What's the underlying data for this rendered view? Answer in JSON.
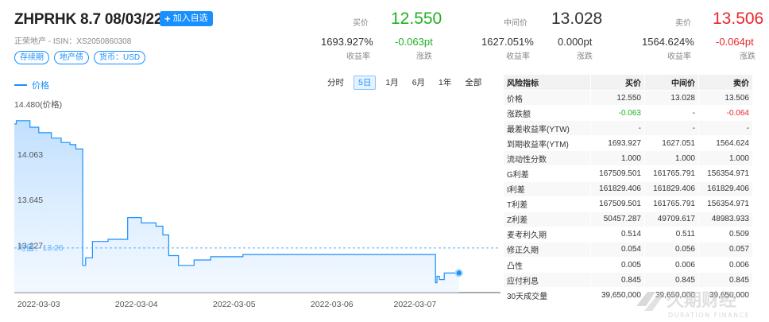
{
  "header": {
    "title": "ZHPRHK 8.7 08/03/22",
    "add_button": "加入自选",
    "subtitle": "正荣地产 - ISIN：XS2050860308",
    "tags": [
      "存续期",
      "地产债",
      "货币：USD"
    ]
  },
  "quotes": {
    "bid": {
      "label": "买价",
      "price": "12.550",
      "yield": "1693.927%",
      "yield_label": "收益率",
      "change": "-0.063pt",
      "change_label": "涨跌"
    },
    "mid": {
      "label": "中间价",
      "price": "13.028",
      "yield": "1627.051%",
      "yield_label": "收益率",
      "change": "0.000pt",
      "change_label": "涨跌"
    },
    "ask": {
      "label": "卖价",
      "price": "13.506",
      "yield": "1564.624%",
      "yield_label": "收益率",
      "change": "-0.064pt",
      "change_label": "涨跌"
    }
  },
  "colors": {
    "accent": "#1890ff",
    "up": "#e8262b",
    "down": "#21b025"
  },
  "chart_controls": {
    "legend": "价格",
    "ranges": [
      "分时",
      "5日",
      "1月",
      "6月",
      "1年",
      "全部"
    ],
    "active_range": "5日"
  },
  "chart_data": {
    "type": "area",
    "y_axis_title": "14.480(价格)",
    "yticks": [
      "14.063",
      "13.645",
      "13.227"
    ],
    "ylim": [
      12.85,
      14.48
    ],
    "avg_label": "均值：13.26",
    "avg_value": 13.26,
    "x_labels": [
      "2022-03-03",
      "2022-03-04",
      "2022-03-05",
      "2022-03-06",
      "2022-03-07"
    ],
    "x_label_t": [
      0.25,
      1.25,
      2.25,
      3.25,
      4.1
    ],
    "x_range": [
      0,
      4.65
    ],
    "series": [
      {
        "t": [
          0,
          0.02,
          0.02,
          0.16,
          0.16,
          0.25,
          0.25,
          0.38,
          0.38,
          0.48,
          0.48,
          0.57,
          0.57,
          0.63,
          0.63,
          0.7,
          0.7,
          0.73,
          0.73,
          0.8,
          0.8,
          0.96,
          0.96,
          1.16,
          1.16,
          1.3,
          1.3,
          1.45,
          1.45,
          1.52,
          1.52,
          1.58,
          1.58,
          1.68,
          1.68,
          1.84,
          1.84,
          2.01,
          2.01,
          2.34,
          2.34,
          4.31,
          4.31,
          4.325,
          4.325,
          4.35,
          4.35,
          4.4,
          4.4,
          4.55
        ],
        "values": [
          14.4,
          14.4,
          14.43,
          14.43,
          14.37,
          14.37,
          14.32,
          14.32,
          14.27,
          14.27,
          14.23,
          14.23,
          14.21,
          14.21,
          14.17,
          14.17,
          13.1,
          13.1,
          13.17,
          13.17,
          13.32,
          13.32,
          13.34,
          13.34,
          13.54,
          13.54,
          13.49,
          13.49,
          13.46,
          13.46,
          13.38,
          13.38,
          13.19,
          13.19,
          13.1,
          13.1,
          13.15,
          13.15,
          13.18,
          13.18,
          13.2,
          13.2,
          12.94,
          12.94,
          13.0,
          13.0,
          12.97,
          12.97,
          13.03,
          13.03
        ]
      }
    ],
    "last_value": 13.03
  },
  "table": {
    "headers": [
      "风险指标",
      "买价",
      "中间价",
      "卖价"
    ],
    "rows": [
      [
        "价格",
        "12.550",
        "13.028",
        "13.506"
      ],
      [
        "涨跌额",
        "-0.063",
        "-",
        "-0.064"
      ],
      [
        "最差收益率(YTW)",
        "-",
        "-",
        "-"
      ],
      [
        "到期收益率(YTM)",
        "1693.927",
        "1627.051",
        "1564.624"
      ],
      [
        "流动性分数",
        "1.000",
        "1.000",
        "1.000"
      ],
      [
        "G利差",
        "167509.501",
        "161765.791",
        "156354.971"
      ],
      [
        "I利差",
        "161829.406",
        "161829.406",
        "161829.406"
      ],
      [
        "T利差",
        "167509.501",
        "161765.791",
        "156354.971"
      ],
      [
        "Z利差",
        "50457.287",
        "49709.617",
        "48983.933"
      ],
      [
        "麦考利久期",
        "0.514",
        "0.511",
        "0.509"
      ],
      [
        "修正久期",
        "0.054",
        "0.056",
        "0.057"
      ],
      [
        "凸性",
        "0.005",
        "0.006",
        "0.006"
      ],
      [
        "应付利息",
        "0.845",
        "0.845",
        "0.845"
      ],
      [
        "30天成交量",
        "39,650,000",
        "39,650,000",
        "39,650,000"
      ]
    ]
  },
  "watermark": {
    "text_cn": "久期财经",
    "text_en": "DURATION FINANCE"
  }
}
